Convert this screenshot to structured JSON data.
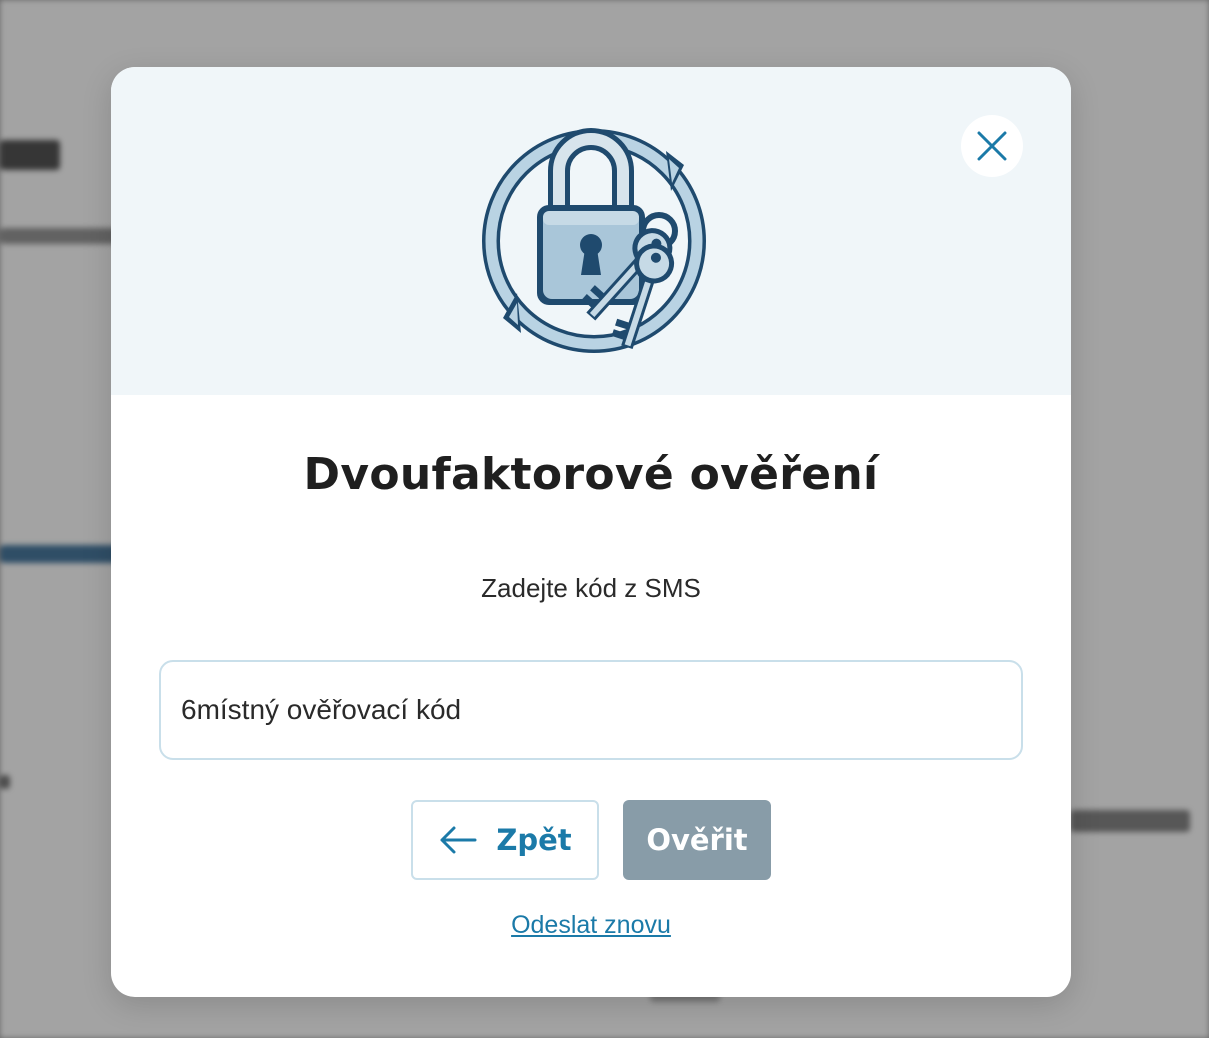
{
  "dialog": {
    "title": "Dvoufaktorové ověření",
    "subtitle": "Zadejte kód z SMS",
    "code_input": {
      "placeholder": "6místný ověřovací kód",
      "value": ""
    },
    "back_button_label": "Zpět",
    "verify_button_label": "Ověřit",
    "resend_link_label": "Odeslat znovu",
    "illustration_icon": "padlock-with-keys-icon",
    "close_icon": "close-icon"
  },
  "colors": {
    "accent": "#1b7aa8",
    "header_background": "#f0f6f9",
    "verify_button_disabled": "#889ca8",
    "input_border": "#c9dfea"
  }
}
